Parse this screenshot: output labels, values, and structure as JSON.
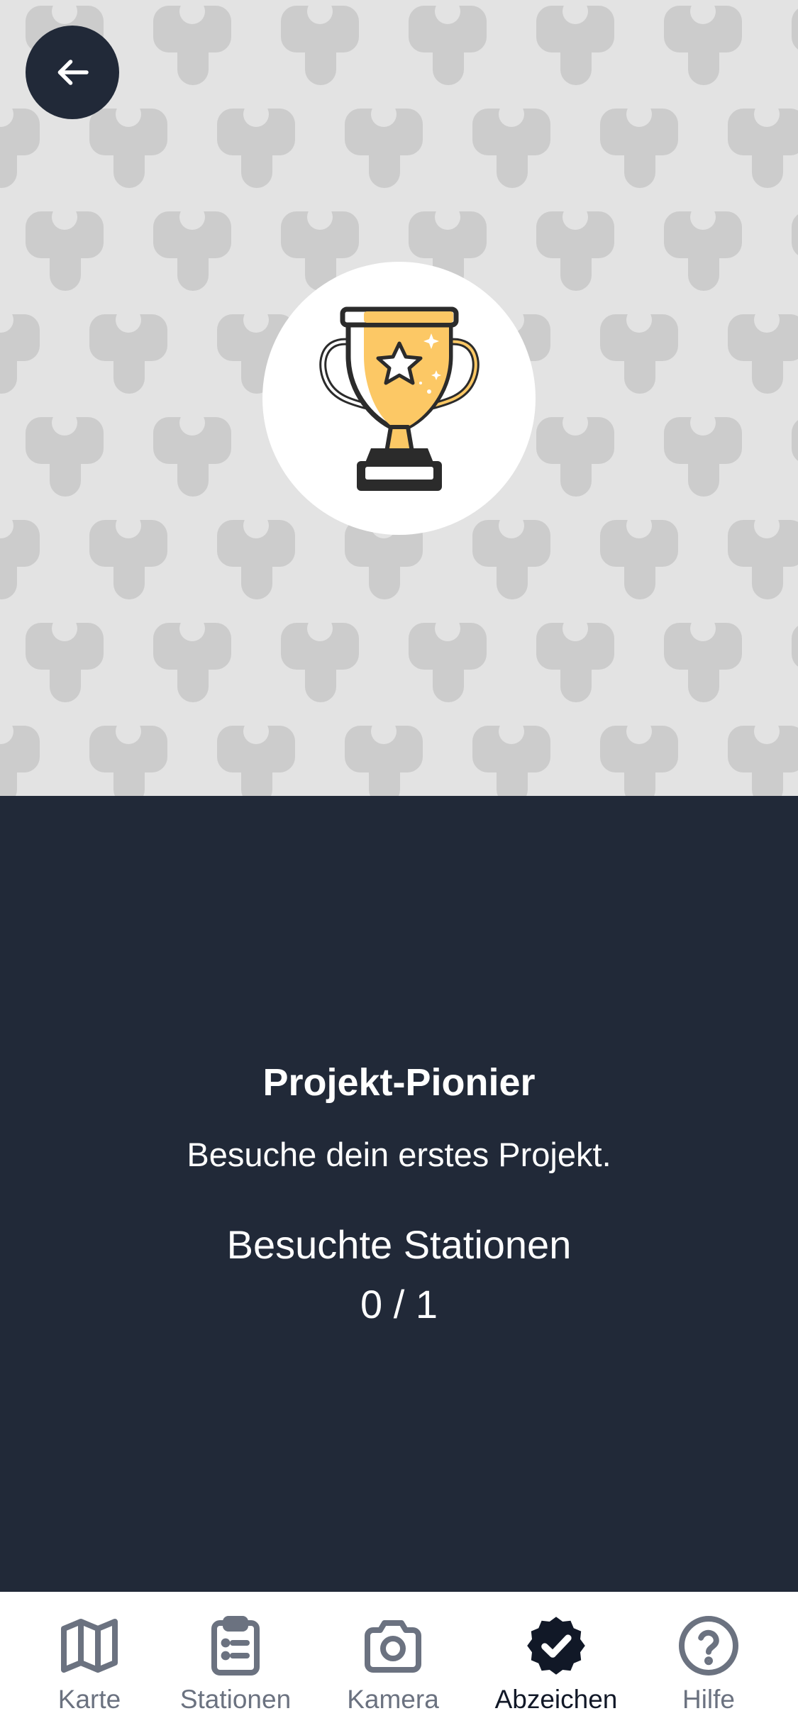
{
  "header": {
    "back_icon": "arrow-left-icon"
  },
  "badge": {
    "icon": "trophy-icon",
    "title": "Projekt-Pionier",
    "description": "Besuche dein erstes Projekt.",
    "progress_label": "Besuchte Stationen",
    "progress_text": "0 / 1",
    "progress_current": 0,
    "progress_total": 1
  },
  "tabs": [
    {
      "label": "Karte",
      "icon": "map-icon",
      "active": false
    },
    {
      "label": "Stationen",
      "icon": "clipboard-list-icon",
      "active": false
    },
    {
      "label": "Kamera",
      "icon": "camera-icon",
      "active": false
    },
    {
      "label": "Abzeichen",
      "icon": "badge-check-icon",
      "active": true
    },
    {
      "label": "Hilfe",
      "icon": "help-circle-icon",
      "active": false
    }
  ],
  "colors": {
    "dark": "#212938",
    "pattern_bg": "#e3e3e3",
    "pattern_shape": "#cccccc",
    "trophy_gold": "#fcc865",
    "tab_inactive": "#6b7280",
    "tab_active": "#111827"
  }
}
